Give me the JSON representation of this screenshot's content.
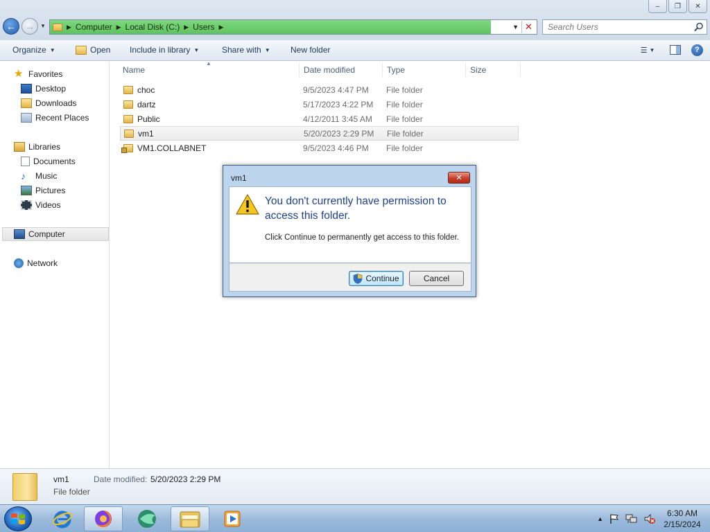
{
  "window": {
    "breadcrumb": [
      "Computer",
      "Local Disk (C:)",
      "Users"
    ],
    "search_placeholder": "Search Users",
    "controls": [
      "minimize",
      "restore",
      "close"
    ]
  },
  "toolbar": {
    "organize": "Organize",
    "open": "Open",
    "include_in_library": "Include in library",
    "share_with": "Share with",
    "new_folder": "New folder"
  },
  "navigation": {
    "favorites": {
      "label": "Favorites",
      "items": [
        "Desktop",
        "Downloads",
        "Recent Places"
      ]
    },
    "libraries": {
      "label": "Libraries",
      "items": [
        "Documents",
        "Music",
        "Pictures",
        "Videos"
      ]
    },
    "computer": "Computer",
    "network": "Network"
  },
  "columns": {
    "name": "Name",
    "date_modified": "Date modified",
    "type": "Type",
    "size": "Size"
  },
  "files": [
    {
      "name": "choc",
      "date": "9/5/2023 4:47 PM",
      "type": "File folder"
    },
    {
      "name": "dartz",
      "date": "5/17/2023 4:22 PM",
      "type": "File folder"
    },
    {
      "name": "Public",
      "date": "4/12/2011 3:45 AM",
      "type": "File folder"
    },
    {
      "name": "vm1",
      "date": "5/20/2023 2:29 PM",
      "type": "File folder"
    },
    {
      "name": "VM1.COLLABNET",
      "date": "9/5/2023 4:46 PM",
      "type": "File folder"
    }
  ],
  "details": {
    "name": "vm1",
    "type": "File folder",
    "date_label": "Date modified:",
    "date_value": "5/20/2023 2:29 PM"
  },
  "dialog": {
    "title": "vm1",
    "message": "You don't currently have permission to access this folder.",
    "submessage": "Click Continue to permanently get access to this folder.",
    "continue": "Continue",
    "cancel": "Cancel"
  },
  "taskbar": {
    "time": "6:30 AM",
    "date": "2/15/2024",
    "apps": [
      "internet-explorer",
      "firefox",
      "app-green",
      "windows-explorer",
      "media-player"
    ]
  },
  "colors": {
    "address_progress": "#5ec45e",
    "dialog_heading": "#1f3f8f",
    "taskbar": "#9dbbdb"
  }
}
